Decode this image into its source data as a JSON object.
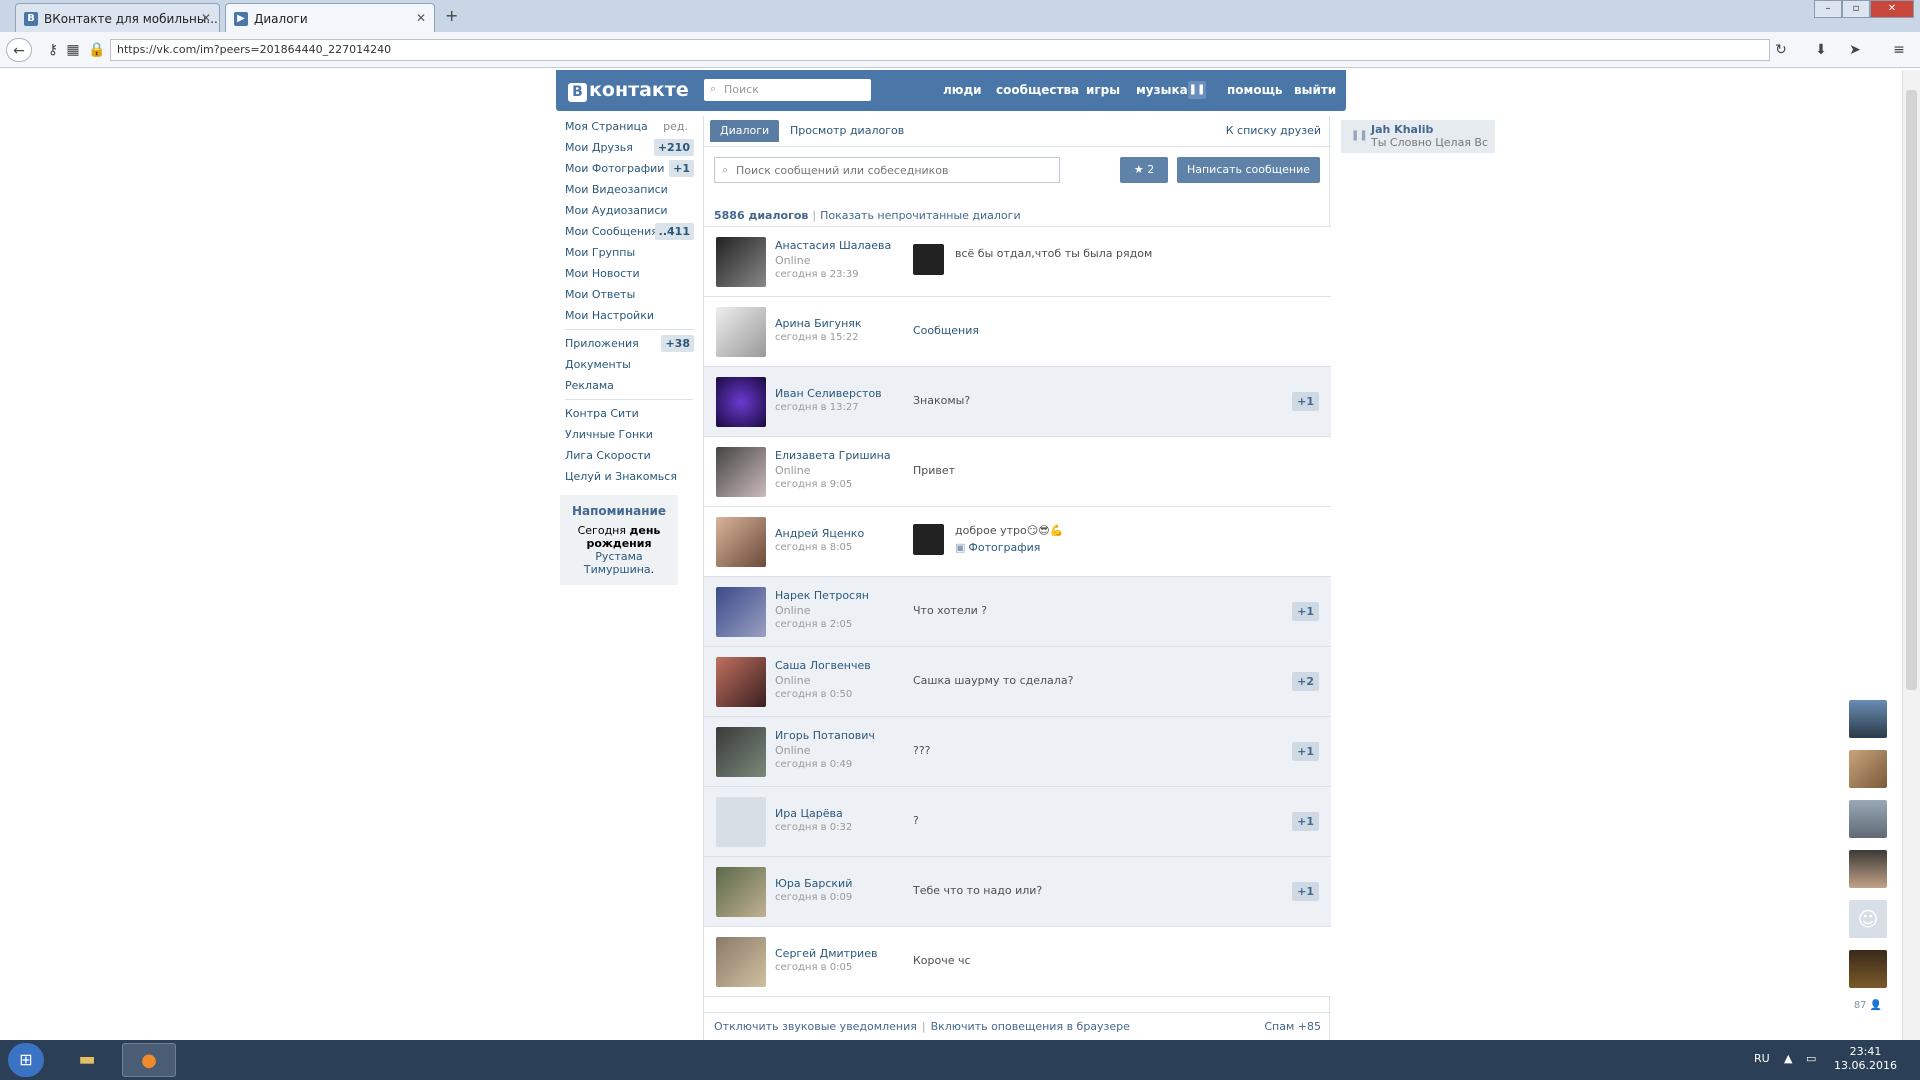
{
  "browser": {
    "tabs": [
      {
        "label": "ВКонтакте для мобильны...",
        "active": false
      },
      {
        "label": "Диалоги",
        "active": true
      }
    ],
    "url": "https://vk.com/im?peers=201864440_227014240"
  },
  "header": {
    "logo": "контакте",
    "search_placeholder": "Поиск",
    "menu": [
      "люди",
      "сообщества",
      "игры",
      "музыка",
      "помощь",
      "выйти"
    ]
  },
  "leftnav": {
    "edit_label": "ред.",
    "items": [
      {
        "label": "Моя Страница",
        "count": ""
      },
      {
        "label": "Мои Друзья",
        "count": "+210"
      },
      {
        "label": "Мои Фотографии",
        "count": "+1"
      },
      {
        "label": "Мои Видеозаписи",
        "count": ""
      },
      {
        "label": "Мои Аудиозаписи",
        "count": ""
      },
      {
        "label": "Мои Сообщения",
        "count": "..411"
      },
      {
        "label": "Мои Группы",
        "count": ""
      },
      {
        "label": "Мои Новости",
        "count": ""
      },
      {
        "label": "Мои Ответы",
        "count": ""
      },
      {
        "label": "Мои Настройки",
        "count": ""
      }
    ],
    "apps": [
      {
        "label": "Приложения",
        "count": "+38"
      },
      {
        "label": "Документы",
        "count": ""
      },
      {
        "label": "Реклама",
        "count": ""
      }
    ],
    "games": [
      "Контра Сити",
      "Уличные Гонки",
      "Лига Скорости",
      "Целуй и Знакомься"
    ],
    "reminder": {
      "title": "Напоминание",
      "text_before": "Сегодня",
      "text_bold": "день рождения",
      "name": "Рустама Тимуршина",
      "text_after": "."
    }
  },
  "main": {
    "tab_dialogs": "Диалоги",
    "tab_view": "Просмотр диалогов",
    "friends_link": "К списку друзей",
    "search_placeholder": "Поиск сообщений или собеседников",
    "star_count": "2",
    "write_button": "Написать сообщение",
    "summary_count": "5886 диалогов",
    "show_unread": "Показать непрочитанные диалоги",
    "dialogs": [
      {
        "name": "Анастасия Шалаева",
        "online": "Online",
        "time": "сегодня в 23:39",
        "message": "всё бы отдал,чтоб ты была рядом",
        "sub": "",
        "badge": "",
        "unread": false,
        "thumb": true
      },
      {
        "name": "Арина Бигуняк",
        "online": "",
        "time": "сегодня в 15:22",
        "message": "Сообщения",
        "sub": "",
        "badge": "",
        "unread": false,
        "thumb": false
      },
      {
        "name": "Иван Селиверстов",
        "online": "",
        "time": "сегодня в 13:27",
        "message": "Знакомы?",
        "sub": "",
        "badge": "+1",
        "unread": true,
        "thumb": false
      },
      {
        "name": "Елизавета Гришина",
        "online": "Online",
        "time": "сегодня в 9:05",
        "message": "Привет",
        "sub": "",
        "badge": "",
        "unread": false,
        "thumb": false
      },
      {
        "name": "Андрей Яценко",
        "online": "",
        "time": "сегодня в 8:05",
        "message": "доброе утро😏😎💪",
        "sub": "Фотография",
        "badge": "",
        "unread": false,
        "thumb": true
      },
      {
        "name": "Нарек Петросян",
        "online": "Online",
        "time": "сегодня в 2:05",
        "message": "Что хотели ?",
        "sub": "",
        "badge": "+1",
        "unread": true,
        "thumb": false
      },
      {
        "name": "Саша Логвенчев",
        "online": "Online",
        "time": "сегодня в 0:50",
        "message": "Сашка шаурму то сделала?",
        "sub": "",
        "badge": "+2",
        "unread": true,
        "thumb": false
      },
      {
        "name": "Игорь Потапович",
        "online": "Online",
        "time": "сегодня в 0:49",
        "message": "???",
        "sub": "",
        "badge": "+1",
        "unread": true,
        "thumb": false
      },
      {
        "name": "Ира Царёва",
        "online": "",
        "time": "сегодня в 0:32",
        "message": "?",
        "sub": "",
        "badge": "+1",
        "unread": true,
        "thumb": false
      },
      {
        "name": "Юра Барский",
        "online": "",
        "time": "сегодня в 0:09",
        "message": "Тебе что то надо или?",
        "sub": "",
        "badge": "+1",
        "unread": true,
        "thumb": false
      },
      {
        "name": "Сергей Дмитриев",
        "online": "",
        "time": "сегодня в 0:05",
        "message": "Короче чс",
        "sub": "",
        "badge": "",
        "unread": false,
        "thumb": false
      }
    ],
    "footer_sound": "Отключить звуковые уведомления",
    "footer_notify": "Включить оповещения в браузере",
    "footer_spam": "Спам +85"
  },
  "music_widget": {
    "artist": "Jah Khalib",
    "track": "Ты Словно Целая Вс..."
  },
  "friends_bar": {
    "count": "87"
  },
  "taskbar": {
    "lang": "RU",
    "time": "23:41",
    "date": "13.06.2016"
  },
  "colors": {
    "vk_blue": "#4a76a8",
    "link": "#2b587a",
    "unread_row": "#edf1f5"
  }
}
